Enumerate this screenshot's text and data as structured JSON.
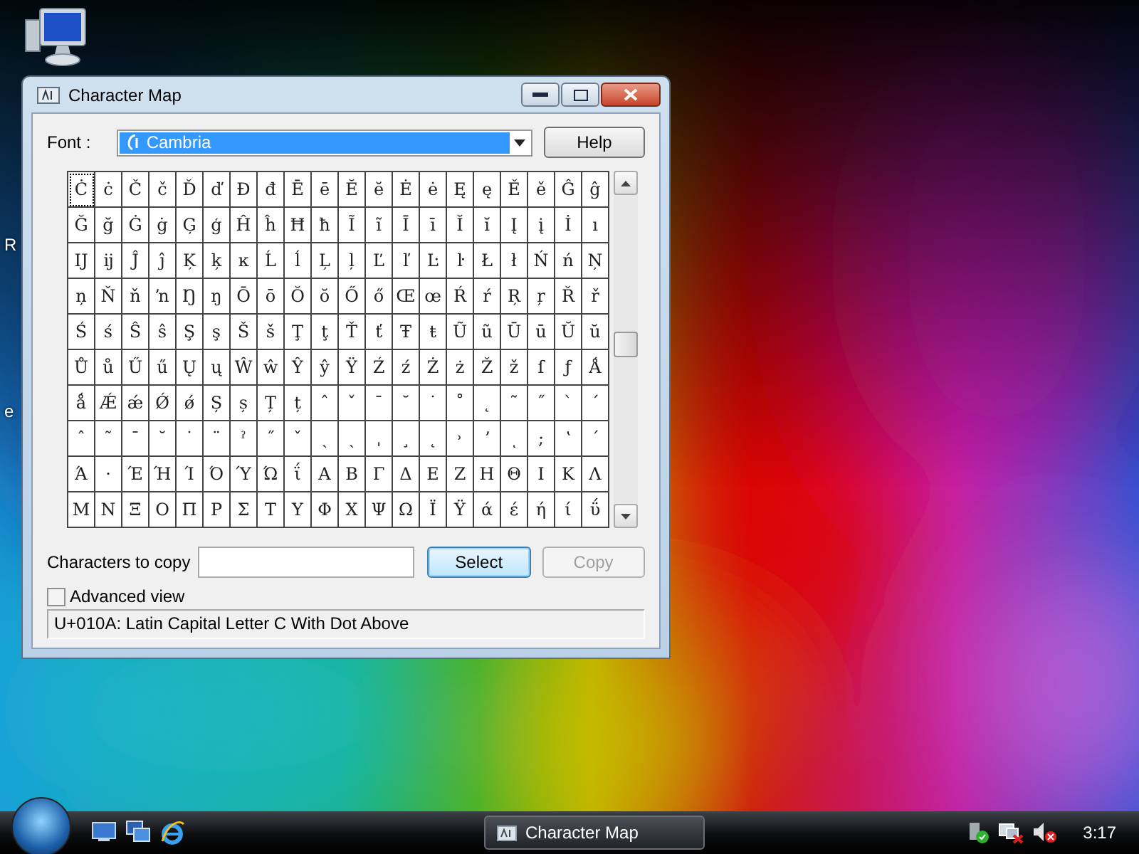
{
  "desktop": {
    "icon_labels": [
      "R",
      "e"
    ]
  },
  "window": {
    "title": "Character Map",
    "font_label": "Font :",
    "font_value": "Cambria",
    "help_button": "Help",
    "grid": [
      {
        "cells": [
          {
            "char": "Ċ",
            "selected": true
          },
          {
            "char": "ċ",
            "selected": false
          },
          {
            "char": "Č",
            "selected": false
          },
          {
            "char": "č",
            "selected": false
          },
          {
            "char": "Ď",
            "selected": false
          },
          {
            "char": "ď",
            "selected": false
          },
          {
            "char": "Đ",
            "selected": false
          },
          {
            "char": "đ",
            "selected": false
          },
          {
            "char": "Ē",
            "selected": false
          },
          {
            "char": "ē",
            "selected": false
          },
          {
            "char": "Ĕ",
            "selected": false
          },
          {
            "char": "ĕ",
            "selected": false
          },
          {
            "char": "Ė",
            "selected": false
          },
          {
            "char": "ė",
            "selected": false
          },
          {
            "char": "Ę",
            "selected": false
          },
          {
            "char": "ę",
            "selected": false
          },
          {
            "char": "Ě",
            "selected": false
          },
          {
            "char": "ě",
            "selected": false
          },
          {
            "char": "Ĝ",
            "selected": false
          },
          {
            "char": "ĝ",
            "selected": false
          }
        ]
      },
      {
        "cells": [
          {
            "char": "Ğ",
            "selected": false
          },
          {
            "char": "ğ",
            "selected": false
          },
          {
            "char": "Ġ",
            "selected": false
          },
          {
            "char": "ġ",
            "selected": false
          },
          {
            "char": "Ģ",
            "selected": false
          },
          {
            "char": "ģ",
            "selected": false
          },
          {
            "char": "Ĥ",
            "selected": false
          },
          {
            "char": "ĥ",
            "selected": false
          },
          {
            "char": "Ħ",
            "selected": false
          },
          {
            "char": "ħ",
            "selected": false
          },
          {
            "char": "Ĩ",
            "selected": false
          },
          {
            "char": "ĩ",
            "selected": false
          },
          {
            "char": "Ī",
            "selected": false
          },
          {
            "char": "ī",
            "selected": false
          },
          {
            "char": "Ĭ",
            "selected": false
          },
          {
            "char": "ĭ",
            "selected": false
          },
          {
            "char": "Į",
            "selected": false
          },
          {
            "char": "į",
            "selected": false
          },
          {
            "char": "İ",
            "selected": false
          },
          {
            "char": "ı",
            "selected": false
          }
        ]
      },
      {
        "cells": [
          {
            "char": "Ĳ",
            "selected": false
          },
          {
            "char": "ĳ",
            "selected": false
          },
          {
            "char": "Ĵ",
            "selected": false
          },
          {
            "char": "ĵ",
            "selected": false
          },
          {
            "char": "Ķ",
            "selected": false
          },
          {
            "char": "ķ",
            "selected": false
          },
          {
            "char": "ĸ",
            "selected": false
          },
          {
            "char": "Ĺ",
            "selected": false
          },
          {
            "char": "ĺ",
            "selected": false
          },
          {
            "char": "Ļ",
            "selected": false
          },
          {
            "char": "ļ",
            "selected": false
          },
          {
            "char": "Ľ",
            "selected": false
          },
          {
            "char": "ľ",
            "selected": false
          },
          {
            "char": "Ŀ",
            "selected": false
          },
          {
            "char": "ŀ",
            "selected": false
          },
          {
            "char": "Ł",
            "selected": false
          },
          {
            "char": "ł",
            "selected": false
          },
          {
            "char": "Ń",
            "selected": false
          },
          {
            "char": "ń",
            "selected": false
          },
          {
            "char": "Ņ",
            "selected": false
          }
        ]
      },
      {
        "cells": [
          {
            "char": "ņ",
            "selected": false
          },
          {
            "char": "Ň",
            "selected": false
          },
          {
            "char": "ň",
            "selected": false
          },
          {
            "char": "ŉ",
            "selected": false
          },
          {
            "char": "Ŋ",
            "selected": false
          },
          {
            "char": "ŋ",
            "selected": false
          },
          {
            "char": "Ō",
            "selected": false
          },
          {
            "char": "ō",
            "selected": false
          },
          {
            "char": "Ŏ",
            "selected": false
          },
          {
            "char": "ŏ",
            "selected": false
          },
          {
            "char": "Ő",
            "selected": false
          },
          {
            "char": "ő",
            "selected": false
          },
          {
            "char": "Œ",
            "selected": false
          },
          {
            "char": "œ",
            "selected": false
          },
          {
            "char": "Ŕ",
            "selected": false
          },
          {
            "char": "ŕ",
            "selected": false
          },
          {
            "char": "Ŗ",
            "selected": false
          },
          {
            "char": "ŗ",
            "selected": false
          },
          {
            "char": "Ř",
            "selected": false
          },
          {
            "char": "ř",
            "selected": false
          }
        ]
      },
      {
        "cells": [
          {
            "char": "Ś",
            "selected": false
          },
          {
            "char": "ś",
            "selected": false
          },
          {
            "char": "Ŝ",
            "selected": false
          },
          {
            "char": "ŝ",
            "selected": false
          },
          {
            "char": "Ş",
            "selected": false
          },
          {
            "char": "ş",
            "selected": false
          },
          {
            "char": "Š",
            "selected": false
          },
          {
            "char": "š",
            "selected": false
          },
          {
            "char": "Ţ",
            "selected": false
          },
          {
            "char": "ţ",
            "selected": false
          },
          {
            "char": "Ť",
            "selected": false
          },
          {
            "char": "ť",
            "selected": false
          },
          {
            "char": "Ŧ",
            "selected": false
          },
          {
            "char": "ŧ",
            "selected": false
          },
          {
            "char": "Ũ",
            "selected": false
          },
          {
            "char": "ũ",
            "selected": false
          },
          {
            "char": "Ū",
            "selected": false
          },
          {
            "char": "ū",
            "selected": false
          },
          {
            "char": "Ŭ",
            "selected": false
          },
          {
            "char": "ŭ",
            "selected": false
          }
        ]
      },
      {
        "cells": [
          {
            "char": "Ů",
            "selected": false
          },
          {
            "char": "ů",
            "selected": false
          },
          {
            "char": "Ű",
            "selected": false
          },
          {
            "char": "ű",
            "selected": false
          },
          {
            "char": "Ų",
            "selected": false
          },
          {
            "char": "ų",
            "selected": false
          },
          {
            "char": "Ŵ",
            "selected": false
          },
          {
            "char": "ŵ",
            "selected": false
          },
          {
            "char": "Ŷ",
            "selected": false
          },
          {
            "char": "ŷ",
            "selected": false
          },
          {
            "char": "Ÿ",
            "selected": false
          },
          {
            "char": "Ź",
            "selected": false
          },
          {
            "char": "ź",
            "selected": false
          },
          {
            "char": "Ż",
            "selected": false
          },
          {
            "char": "ż",
            "selected": false
          },
          {
            "char": "Ž",
            "selected": false
          },
          {
            "char": "ž",
            "selected": false
          },
          {
            "char": "ſ",
            "selected": false
          },
          {
            "char": "ƒ",
            "selected": false
          },
          {
            "char": "Ǻ",
            "selected": false
          }
        ]
      },
      {
        "cells": [
          {
            "char": "ǻ",
            "selected": false
          },
          {
            "char": "Ǽ",
            "selected": false
          },
          {
            "char": "ǽ",
            "selected": false
          },
          {
            "char": "Ǿ",
            "selected": false
          },
          {
            "char": "ǿ",
            "selected": false
          },
          {
            "char": "Ș",
            "selected": false
          },
          {
            "char": "ș",
            "selected": false
          },
          {
            "char": "Ț",
            "selected": false
          },
          {
            "char": "ț",
            "selected": false
          },
          {
            "char": "ˆ",
            "selected": false
          },
          {
            "char": "ˇ",
            "selected": false
          },
          {
            "char": "ˉ",
            "selected": false
          },
          {
            "char": "˘",
            "selected": false
          },
          {
            "char": "˙",
            "selected": false
          },
          {
            "char": "˚",
            "selected": false
          },
          {
            "char": "˛",
            "selected": false
          },
          {
            "char": "˜",
            "selected": false
          },
          {
            "char": "˝",
            "selected": false
          },
          {
            "char": "ˋ",
            "selected": false
          },
          {
            "char": "ˊ",
            "selected": false
          }
        ]
      },
      {
        "cells": [
          {
            "char": "ˆ",
            "selected": false
          },
          {
            "char": "˜",
            "selected": false
          },
          {
            "char": "¯",
            "selected": false
          },
          {
            "char": "˘",
            "selected": false
          },
          {
            "char": "˙",
            "selected": false
          },
          {
            "char": "¨",
            "selected": false
          },
          {
            "char": "ˀ",
            "selected": false
          },
          {
            "char": "˝",
            "selected": false
          },
          {
            "char": "ˇ",
            "selected": false
          },
          {
            "char": "ˎ",
            "selected": false
          },
          {
            "char": "ˏ",
            "selected": false
          },
          {
            "char": "ˌ",
            "selected": false
          },
          {
            "char": "¸",
            "selected": false
          },
          {
            "char": "˛",
            "selected": false
          },
          {
            "char": "˒",
            "selected": false
          },
          {
            "char": "ʼ",
            "selected": false
          },
          {
            "char": "ͺ",
            "selected": false
          },
          {
            "char": ";",
            "selected": false
          },
          {
            "char": "ʽ",
            "selected": false
          },
          {
            "char": "΄",
            "selected": false
          }
        ]
      },
      {
        "cells": [
          {
            "char": "Ά",
            "selected": false
          },
          {
            "char": "·",
            "selected": false
          },
          {
            "char": "Έ",
            "selected": false
          },
          {
            "char": "Ή",
            "selected": false
          },
          {
            "char": "Ί",
            "selected": false
          },
          {
            "char": "Ό",
            "selected": false
          },
          {
            "char": "Ύ",
            "selected": false
          },
          {
            "char": "Ώ",
            "selected": false
          },
          {
            "char": "ΐ",
            "selected": false
          },
          {
            "char": "Α",
            "selected": false
          },
          {
            "char": "Β",
            "selected": false
          },
          {
            "char": "Γ",
            "selected": false
          },
          {
            "char": "Δ",
            "selected": false
          },
          {
            "char": "Ε",
            "selected": false
          },
          {
            "char": "Ζ",
            "selected": false
          },
          {
            "char": "Η",
            "selected": false
          },
          {
            "char": "Θ",
            "selected": false
          },
          {
            "char": "Ι",
            "selected": false
          },
          {
            "char": "Κ",
            "selected": false
          },
          {
            "char": "Λ",
            "selected": false
          }
        ]
      },
      {
        "cells": [
          {
            "char": "Μ",
            "selected": false
          },
          {
            "char": "Ν",
            "selected": false
          },
          {
            "char": "Ξ",
            "selected": false
          },
          {
            "char": "Ο",
            "selected": false
          },
          {
            "char": "Π",
            "selected": false
          },
          {
            "char": "Ρ",
            "selected": false
          },
          {
            "char": "Σ",
            "selected": false
          },
          {
            "char": "Τ",
            "selected": false
          },
          {
            "char": "Υ",
            "selected": false
          },
          {
            "char": "Φ",
            "selected": false
          },
          {
            "char": "Χ",
            "selected": false
          },
          {
            "char": "Ψ",
            "selected": false
          },
          {
            "char": "Ω",
            "selected": false
          },
          {
            "char": "Ϊ",
            "selected": false
          },
          {
            "char": "Ϋ",
            "selected": false
          },
          {
            "char": "ά",
            "selected": false
          },
          {
            "char": "έ",
            "selected": false
          },
          {
            "char": "ή",
            "selected": false
          },
          {
            "char": "ί",
            "selected": false
          },
          {
            "char": "ΰ",
            "selected": false
          }
        ]
      }
    ],
    "copy_label": "Characters to copy",
    "select_button": {
      "label": "Select",
      "disabled": false
    },
    "copy_button": {
      "label": "Copy",
      "disabled": true
    },
    "advanced_view": {
      "label": "Advanced view",
      "checked": false
    },
    "status": "U+010A: Latin Capital Letter C With Dot Above"
  },
  "taskbar": {
    "tasks": [
      {
        "label": "Character Map",
        "selected": true
      }
    ],
    "clock": "3:17"
  }
}
